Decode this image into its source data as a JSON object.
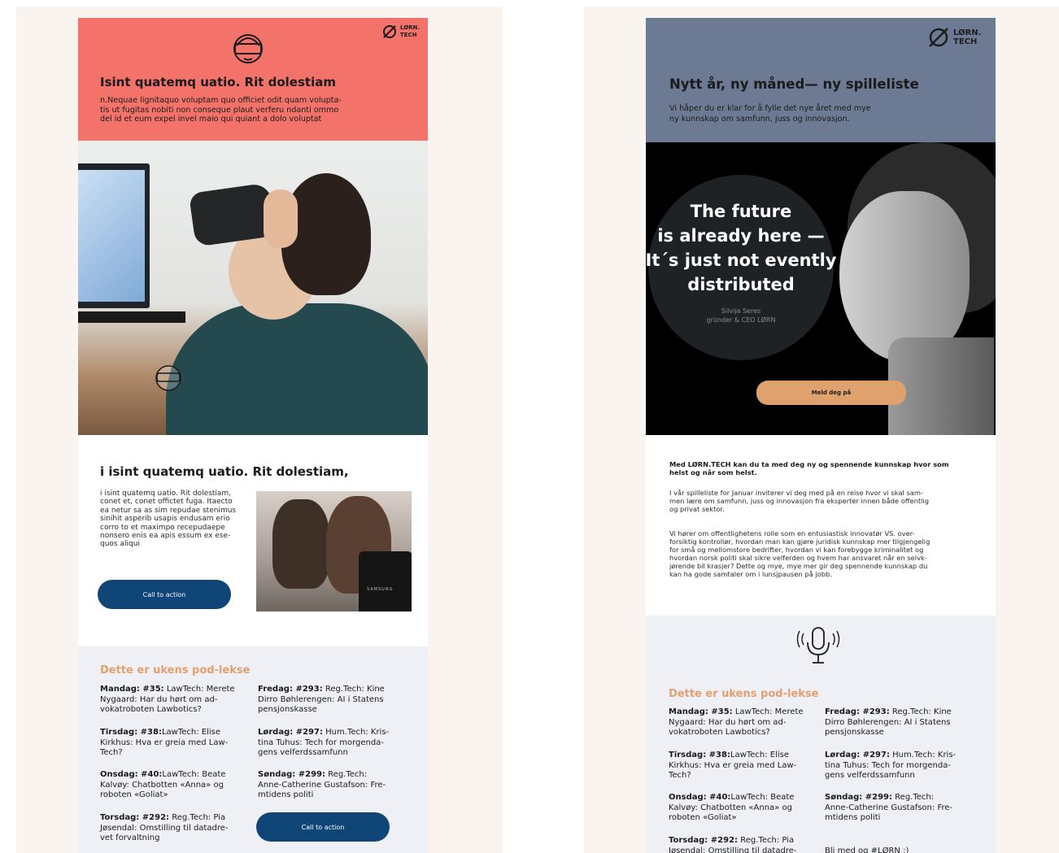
{
  "colors": {
    "coral": "#f3736a",
    "slate": "#6c7a93",
    "navy": "#0f4577",
    "tan": "#dfa26f",
    "cream": "#f9f4ef",
    "lightgray": "#eff0f6"
  },
  "left": {
    "logo": "LØRN.\nTECH",
    "header_icon": "vr-headset-icon",
    "title": "Isint quatemq uatio. Rit dolestiam",
    "intro": "n.Nequae lignitaquo voluptam quo officiet odit quam volupta-\ntis ut fugitas nobiti non conseque plaut verferu ndanti ommo\ndel id et eum expel invel maio qui quiant a dolo voluptat",
    "section_title": "i isint quatemq uatio. Rit dolestiam,",
    "body": "i isint quatemq uatio. Rit dolestiam,\nconet et, conet offictet fuga. Itaecto\nea netur sa as sim repudae stenimus\nsinihit asperib usapis endusam erio\ncorro to et maximpo recepudaepe\nnonsero enis ea apis essum ex ese-\nquos aliqui",
    "cta": "Call to action",
    "photo_label": "SAMSUNG",
    "pod_title": "Dette er ukens pod-lekse",
    "pod_left": [
      {
        "day": "Mandag: #35:",
        "text": " LawTech: Merete\nNygaard: Har du hørt om ad-\nvokatroboten Lawbotics?"
      },
      {
        "day": "Tirsdag: #38:",
        "text": "LawTech: Elise\nKirkhus: Hva er greia med Law-\nTech?"
      },
      {
        "day": "Onsdag: #40:",
        "text": "LawTech: Beate\nKalvøy: Chatbotten «Anna» og\nroboten «Goliat»"
      },
      {
        "day": "Torsdag: #292:",
        "text": " Reg.Tech: Pia\nJøsendal: Omstilling til datadre-\nvet forvaltning"
      }
    ],
    "pod_right": [
      {
        "day": "Fredag: #293:",
        "text": " Reg.Tech: Kine\nDirro Bøhlerengen: AI i Statens\npensjonskasse"
      },
      {
        "day": "Lørdag: #297:",
        "text": " Hum.Tech: Kris-\ntina Tuhus: Tech for morgenda-\ngens velferdssamfunn"
      },
      {
        "day": "Søndag: #299:",
        "text": " Reg.Tech:\nAnne-Catherine Gustafson: Fre-\nmtidens politi"
      }
    ],
    "pod_cta": "Call to action"
  },
  "right": {
    "logo": "LØRN.\nTECH",
    "title": "Nytt år, ny måned— ny spilleliste",
    "intro": "Vi håper du er klar for å fylle det nye året med mye\nny kunnskap om samfunn, juss og innovasjon.",
    "quote": "The future\nis already here —\nIt´s just not evently\ndistributed",
    "quote_author": "Silvija Seres\ngründer & CEO LØRN",
    "cta": "Meld deg på",
    "lead": "Med LØRN.TECH kan du ta med deg ny og spennende kunnskap hvor som\nhelst og når som helst.",
    "para1": "I vår spilleliste for Januar inviterer vi deg med på en reise hvor vi skal sam-\nmen lære om samfunn, juss og innovasjon fra eksperter innen både offentlig\nog privat sektor.",
    "para2": "Vi hører om offentlighetens rolle som en entusiastisk innovatør VS. over-\nforsiktig kontrollør, hvordan man kan gjøre juridisk kunnskap mer tilgjengelig\nfor små og mellomstore bedrifter, hvordan vi kan forebygge kriminalitet og\nhvordan norsk politi skal sikre velferden og hvem har ansvaret når en selvk-\njørende bil krasjer? Dette og mye, mye mer gir deg spennende kunnskap du\nkan ha gode samtaler om i lunsjpausen på jobb.",
    "pod_icon": "microphone-icon",
    "pod_title": "Dette er ukens pod-lekse",
    "pod_left": [
      {
        "day": "Mandag: #35:",
        "text": " LawTech: Merete\nNygaard: Har du hørt om ad-\nvokatroboten Lawbotics?"
      },
      {
        "day": "Tirsdag: #38:",
        "text": "LawTech: Elise\nKirkhus: Hva er greia med Law-\nTech?"
      },
      {
        "day": "Onsdag: #40:",
        "text": "LawTech: Beate\nKalvøy: Chatbotten «Anna» og\nroboten «Goliat»"
      },
      {
        "day": "Torsdag: #292:",
        "text": " Reg.Tech: Pia\nJøsendal: Omstilling til datadre-\nvet forvaltning"
      }
    ],
    "pod_right": [
      {
        "day": "Fredag: #293:",
        "text": " Reg.Tech: Kine\nDirro Bøhlerengen: AI i Statens\npensjonskasse"
      },
      {
        "day": "Lørdag: #297:",
        "text": " Hum.Tech: Kris-\ntina Tuhus: Tech for morgenda-\ngens velferdssamfunn"
      },
      {
        "day": "Søndag: #299:",
        "text": " Reg.Tech:\nAnne-Catherine Gustafson: Fre-\nmtidens politi"
      }
    ],
    "closing": "Bli med og #LØRN :)"
  }
}
